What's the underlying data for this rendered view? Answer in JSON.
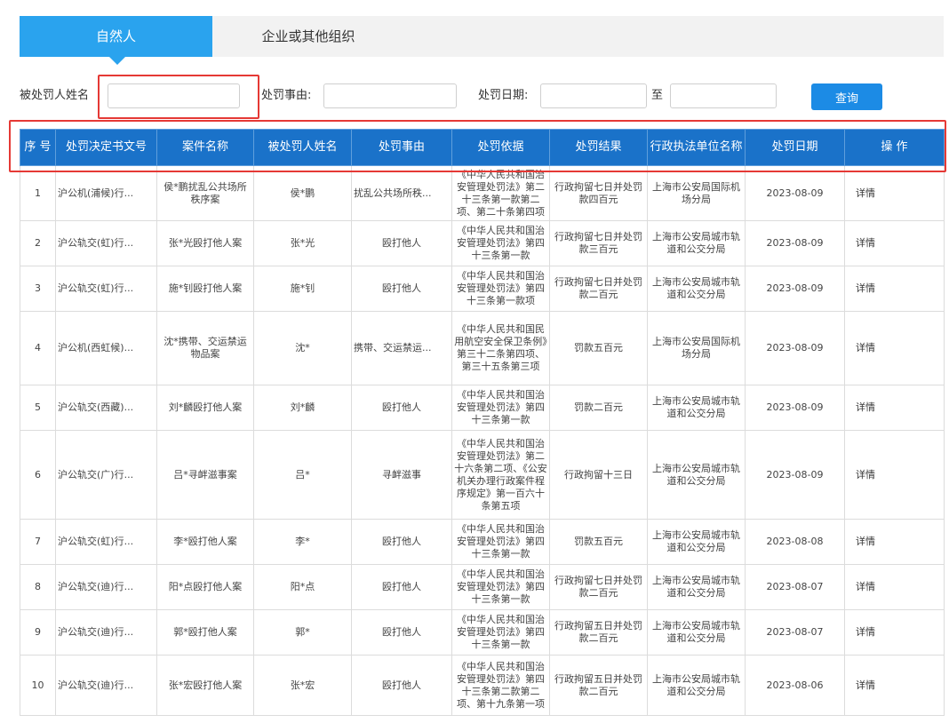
{
  "tabs": [
    {
      "label": "自然人",
      "active": true
    },
    {
      "label": "企业或其他组织",
      "active": false
    }
  ],
  "search": {
    "name_label": "被处罚人姓名",
    "reason_label": "处罚事由:",
    "date_label": "处罚日期:",
    "date_sep": "至",
    "button_label": "查询",
    "name_value": "",
    "reason_value": "",
    "date_from_value": "",
    "date_to_value": ""
  },
  "colors": {
    "tab_active": "#2aa3ee",
    "header_bg": "#1a72c9",
    "button_bg": "#1c8be5",
    "highlight": "#e53935"
  },
  "table": {
    "headers": [
      "序 号",
      "处罚决定书文号",
      "案件名称",
      "被处罚人姓名",
      "处罚事由",
      "处罚依据",
      "处罚结果",
      "行政执法单位名称",
      "处罚日期",
      "操 作"
    ],
    "rows": [
      {
        "no": "1",
        "doc": "沪公机(浦候)行...",
        "case": "侯*鹏扰乱公共场所秩序案",
        "person": "侯*鹏",
        "reason": "扰乱公共场所秩...",
        "basis": "《中华人民共和国治安管理处罚法》第二十三条第一款第二项、第二十条第四项",
        "result": "行政拘留七日并处罚款四百元",
        "unit": "上海市公安局国际机场分局",
        "date": "2023-08-09",
        "action": "详情"
      },
      {
        "no": "2",
        "doc": "沪公轨交(虹)行...",
        "case": "张*光殴打他人案",
        "person": "张*光",
        "reason": "殴打他人",
        "basis": "《中华人民共和国治安管理处罚法》第四十三条第一款",
        "result": "行政拘留七日并处罚款三百元",
        "unit": "上海市公安局城市轨道和公交分局",
        "date": "2023-08-09",
        "action": "详情"
      },
      {
        "no": "3",
        "doc": "沪公轨交(虹)行...",
        "case": "施*钊殴打他人案",
        "person": "施*钊",
        "reason": "殴打他人",
        "basis": "《中华人民共和国治安管理处罚法》第四十三条第一款项",
        "result": "行政拘留七日并处罚款二百元",
        "unit": "上海市公安局城市轨道和公交分局",
        "date": "2023-08-09",
        "action": "详情"
      },
      {
        "no": "4",
        "doc": "沪公机(西虹候)...",
        "case": "沈*携带、交运禁运物品案",
        "person": "沈*",
        "reason": "携带、交运禁运...",
        "basis": "《中华人民共和国民用航空安全保卫条例》第三十二条第四项、第三十五条第三项",
        "result": "罚款五百元",
        "unit": "上海市公安局国际机场分局",
        "date": "2023-08-09",
        "action": "详情"
      },
      {
        "no": "5",
        "doc": "沪公轨交(西藏)...",
        "case": "刘*麟殴打他人案",
        "person": "刘*麟",
        "reason": "殴打他人",
        "basis": "《中华人民共和国治安管理处罚法》第四十三条第一款",
        "result": "罚款二百元",
        "unit": "上海市公安局城市轨道和公交分局",
        "date": "2023-08-09",
        "action": "详情"
      },
      {
        "no": "6",
        "doc": "沪公轨交(广)行...",
        "case": "吕*寻衅滋事案",
        "person": "吕*",
        "reason": "寻衅滋事",
        "basis": "《中华人民共和国治安管理处罚法》第二十六条第二项、《公安机关办理行政案件程序规定》第一百六十条第五项",
        "result": "行政拘留十三日",
        "unit": "上海市公安局城市轨道和公交分局",
        "date": "2023-08-09",
        "action": "详情"
      },
      {
        "no": "7",
        "doc": "沪公轨交(虹)行...",
        "case": "李*殴打他人案",
        "person": "李*",
        "reason": "殴打他人",
        "basis": "《中华人民共和国治安管理处罚法》第四十三条第一款",
        "result": "罚款五百元",
        "unit": "上海市公安局城市轨道和公交分局",
        "date": "2023-08-08",
        "action": "详情"
      },
      {
        "no": "8",
        "doc": "沪公轨交(迪)行...",
        "case": "阳*点殴打他人案",
        "person": "阳*点",
        "reason": "殴打他人",
        "basis": "《中华人民共和国治安管理处罚法》第四十三条第一款",
        "result": "行政拘留七日并处罚款二百元",
        "unit": "上海市公安局城市轨道和公交分局",
        "date": "2023-08-07",
        "action": "详情"
      },
      {
        "no": "9",
        "doc": "沪公轨交(迪)行...",
        "case": "郭*殴打他人案",
        "person": "郭*",
        "reason": "殴打他人",
        "basis": "《中华人民共和国治安管理处罚法》第四十三条第一款",
        "result": "行政拘留五日并处罚款二百元",
        "unit": "上海市公安局城市轨道和公交分局",
        "date": "2023-08-07",
        "action": "详情"
      },
      {
        "no": "10",
        "doc": "沪公轨交(迪)行...",
        "case": "张*宏殴打他人案",
        "person": "张*宏",
        "reason": "殴打他人",
        "basis": "《中华人民共和国治安管理处罚法》第四十三条第二款第二项、第十九条第一项",
        "result": "行政拘留五日并处罚款二百元",
        "unit": "上海市公安局城市轨道和公交分局",
        "date": "2023-08-06",
        "action": "详情"
      }
    ]
  }
}
